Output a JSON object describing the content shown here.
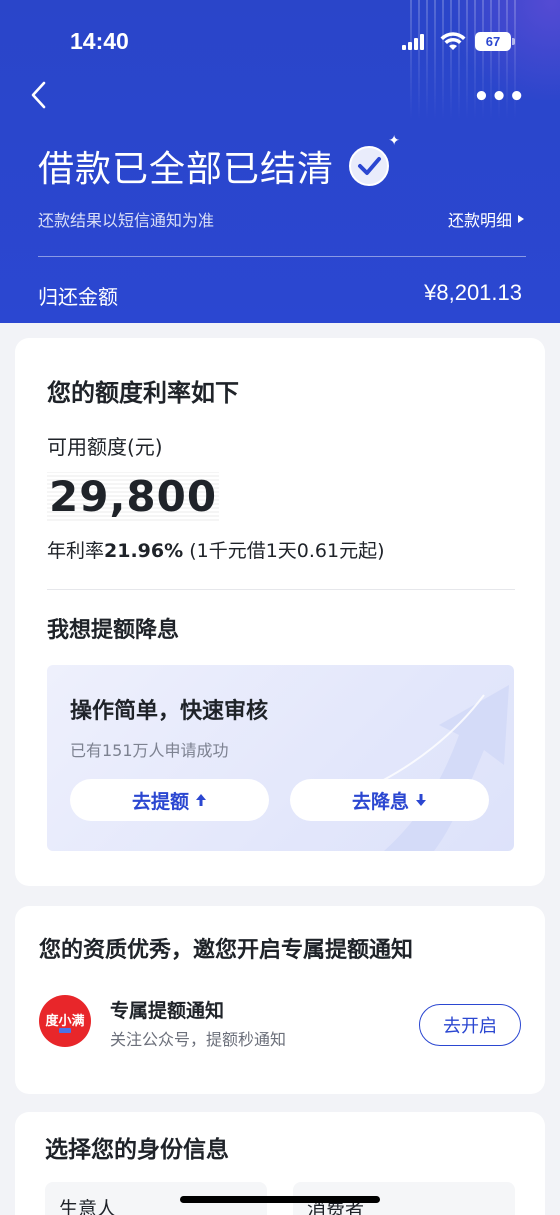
{
  "status_bar": {
    "time": "14:40",
    "battery": "67"
  },
  "header": {
    "title": "借款已全部已结清",
    "subtitle": "还款结果以短信通知为准",
    "detail_link": "还款明细",
    "repay_label": "归还金额",
    "repay_amount": "¥8,201.13",
    "icons": [
      "back-icon",
      "more-icon",
      "check-badge-icon"
    ],
    "colors": {
      "header_bg": "#2b47d1",
      "accent": "#2b47d1"
    }
  },
  "credit_card": {
    "title": "您的额度利率如下",
    "available_label": "可用额度(元)",
    "available_amount": "29,800",
    "rate_prefix": "年利率",
    "rate_value": "21.96%",
    "rate_suffix": " (1千元借1天0.61元起)",
    "section_title": "我想提额降息",
    "promo": {
      "title": "操作简单，快速审核",
      "desc": "已有151万人申请成功",
      "raise_button": "去提额",
      "lower_button": "去降息"
    }
  },
  "notify_card": {
    "title": "您的资质优秀，邀您开启专属提额通知",
    "logo_text": "度小满",
    "item_name": "专属提额通知",
    "item_desc": "关注公众号，提额秒通知",
    "open_button": "去开启",
    "colors": {
      "logo_bg": "#e8262a"
    }
  },
  "identity_card": {
    "title": "选择您的身份信息",
    "options": [
      "生意人",
      "消费者"
    ]
  }
}
